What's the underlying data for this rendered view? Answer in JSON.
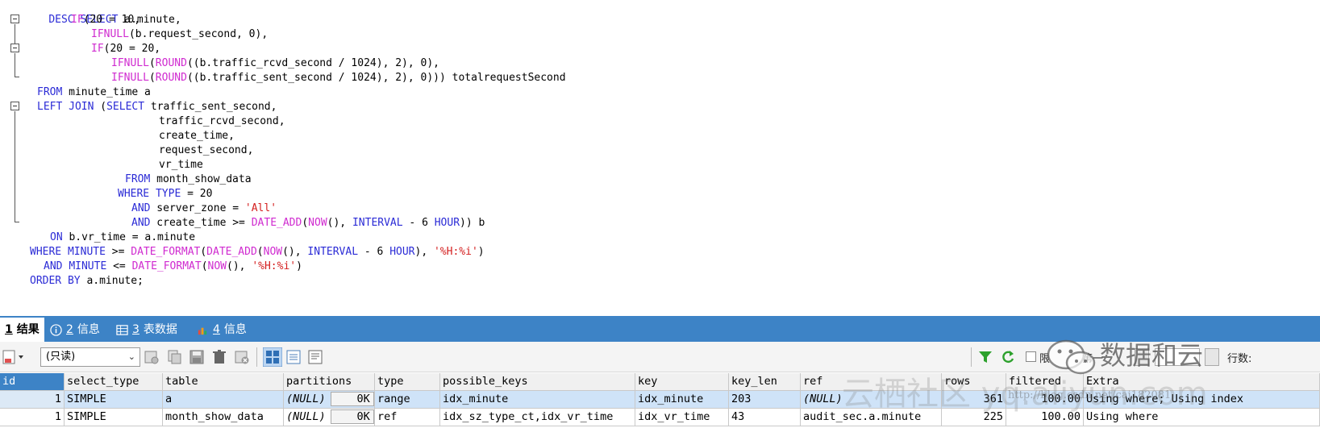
{
  "editor": {
    "lines": [
      "DESC SELECT a.minute,",
      "IF(20 = 10,",
      "IFNULL(b.request_second, 0),",
      "IF(20 = 20,",
      "IFNULL(ROUND((b.traffic_rcvd_second / 1024), 2), 0),",
      "IFNULL(ROUND((b.traffic_sent_second / 1024), 2), 0))) totalrequestSecond",
      "FROM minute_time a",
      "LEFT JOIN (SELECT traffic_sent_second,",
      "traffic_rcvd_second,",
      "create_time,",
      "request_second,",
      "vr_time",
      "FROM month_show_data",
      "WHERE TYPE = 20",
      "AND server_zone = 'All'",
      "AND create_time >= DATE_ADD(NOW(), INTERVAL - 6 HOUR)) b",
      "ON b.vr_time = a.minute",
      "WHERE MINUTE >= DATE_FORMAT(DATE_ADD(NOW(), INTERVAL - 6 HOUR), '%H:%i')",
      "AND MINUTE <= DATE_FORMAT(NOW(), '%H:%i')",
      "ORDER BY a.minute;"
    ]
  },
  "tabs": [
    {
      "num": "1",
      "label": "结果"
    },
    {
      "num": "2",
      "label": "信息"
    },
    {
      "num": "3",
      "label": "表数据"
    },
    {
      "num": "4",
      "label": "信息"
    }
  ],
  "toolbar": {
    "mode_select": "(只读)",
    "limit_label": "限",
    "first_label": "第一",
    "rows_label": "行数:"
  },
  "grid": {
    "columns": [
      "id",
      "select_type",
      "table",
      "partitions",
      "type",
      "possible_keys",
      "key",
      "key_len",
      "ref",
      "rows",
      "filtered",
      "Extra"
    ],
    "rows": [
      {
        "id": "1",
        "select_type": "SIMPLE",
        "table": "a",
        "partitions": "(NULL)",
        "partitions_size": "0K",
        "type": "range",
        "possible_keys": "idx_minute",
        "key": "idx_minute",
        "key_len": "203",
        "ref": "(NULL)",
        "rows": "361",
        "filtered": "100.00",
        "extra": "Using where; Using index"
      },
      {
        "id": "1",
        "select_type": "SIMPLE",
        "table": "month_show_data",
        "partitions": "(NULL)",
        "partitions_size": "0K",
        "type": "ref",
        "possible_keys": "idx_sz_type_ct,idx_vr_time",
        "key": "idx_vr_time",
        "key_len": "43",
        "ref": "audit_sec.a.minute",
        "rows": "225",
        "filtered": "100.00",
        "extra": "Using where"
      }
    ]
  },
  "watermark": {
    "brand": "数据和云",
    "site_text": "云栖社区 yq.aliyun.com",
    "url_text": "http://blog.csdn.net/cai182081"
  },
  "colors": {
    "keyword": "#2b2bd6",
    "function": "#d02bd0",
    "string": "#d42020",
    "accent": "#3d83c6"
  }
}
